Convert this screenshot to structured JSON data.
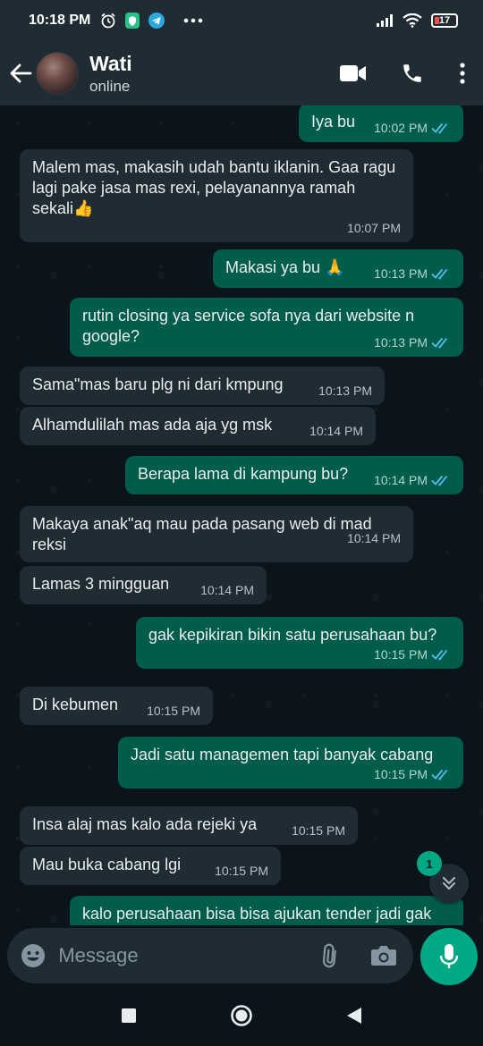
{
  "status_bar": {
    "time": "10:18 PM",
    "icons": [
      "alarm-icon",
      "shield-icon",
      "telegram-icon",
      "more-dots-icon"
    ],
    "right_icons": [
      "signal-icon",
      "wifi-icon",
      "battery-icon"
    ],
    "battery_level": "17"
  },
  "header": {
    "contact_name": "Wati",
    "contact_status": "online",
    "actions": [
      "video-call-icon",
      "phone-icon",
      "menu-icon"
    ]
  },
  "messages": [
    {
      "dir": "out",
      "text": "Iya bu",
      "time": "10:02 PM",
      "read": true
    },
    {
      "dir": "in",
      "text": "Malem mas, makasih udah bantu iklanin. Gaa ragu lagi pake jasa mas rexi, pelayanannya ramah sekali👍",
      "time": "10:07 PM"
    },
    {
      "dir": "out",
      "text": "Makasi ya bu 🙏",
      "time": "10:13 PM",
      "read": true
    },
    {
      "dir": "out",
      "text": "rutin closing ya service sofa nya dari website n google?",
      "time": "10:13 PM",
      "read": true
    },
    {
      "dir": "in",
      "text": "Sama\"mas baru plg ni dari kmpung",
      "time": "10:13 PM"
    },
    {
      "dir": "in",
      "text": "Alhamdulilah mas ada aja yg msk",
      "time": "10:14 PM"
    },
    {
      "dir": "out",
      "text": "Berapa lama di kampung bu?",
      "time": "10:14 PM",
      "read": true
    },
    {
      "dir": "in",
      "text": "Makaya anak\"aq mau pada pasang web di mad reksi",
      "time": "10:14 PM"
    },
    {
      "dir": "in",
      "text": "Lamas 3 mingguan",
      "time": "10:14 PM"
    },
    {
      "dir": "out",
      "text": "gak kepikiran bikin satu perusahaan bu?",
      "time": "10:15 PM",
      "read": true
    },
    {
      "dir": "in",
      "text": "Di kebumen",
      "time": "10:15 PM"
    },
    {
      "dir": "out",
      "text": "Jadi satu managemen tapi banyak cabang",
      "time": "10:15 PM",
      "read": true
    },
    {
      "dir": "in",
      "text": "Insa alaj mas kalo ada rejeki ya",
      "time": "10:15 PM"
    },
    {
      "dir": "in",
      "text": "Mau buka cabang lgi",
      "time": "10:15 PM"
    },
    {
      "dir": "out",
      "text": "kalo perusahaan bisa bisa ajukan tender jadi gak",
      "time": "",
      "read": false
    }
  ],
  "scroll_down": {
    "unread_count": "1"
  },
  "composer": {
    "placeholder": "Message",
    "value": ""
  },
  "colors": {
    "incoming_bubble": "#202c33",
    "outgoing_bubble": "#005c4b",
    "accent": "#00a884",
    "read_ticks": "#53bdeb",
    "background": "#0b141a",
    "bar": "#1f2c34"
  }
}
